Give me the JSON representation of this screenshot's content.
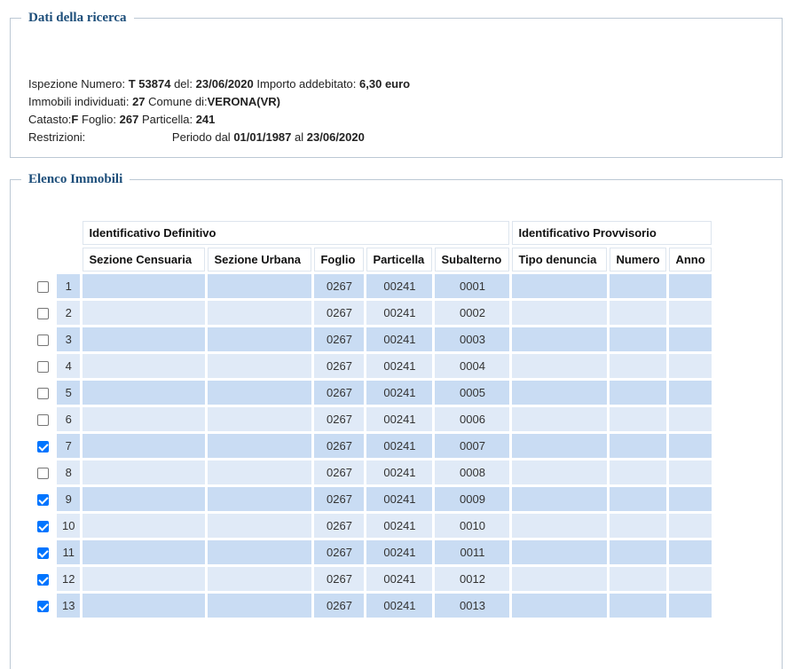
{
  "search": {
    "legend": "Dati della ricerca",
    "ispezione_label": "Ispezione Numero:",
    "ispezione_value": "T 53874",
    "del_label": "del:",
    "del_value": "23/06/2020",
    "importo_label": "Importo addebitato:",
    "importo_value": "6,30 euro",
    "immobili_label": "Immobili individuati:",
    "immobili_value": "27",
    "comune_label": "Comune di:",
    "comune_value": "VERONA(VR)",
    "catasto_label": "Catasto:",
    "catasto_value": "F",
    "foglio_label": "Foglio:",
    "foglio_value": "267",
    "particella_label": "Particella:",
    "particella_value": "241",
    "restrizioni_label": "Restrizioni:",
    "periodo_label": "Periodo dal",
    "periodo_from": "01/01/1987",
    "periodo_al": "al",
    "periodo_to": "23/06/2020"
  },
  "list": {
    "legend": "Elenco Immobili",
    "group_headers": {
      "definitivo": "Identificativo Definitivo",
      "provvisorio": "Identificativo Provvisorio"
    },
    "columns": {
      "sezione_censuaria": "Sezione Censuaria",
      "sezione_urbana": "Sezione Urbana",
      "foglio": "Foglio",
      "particella": "Particella",
      "subalterno": "Subalterno",
      "tipo_denuncia": "Tipo denuncia",
      "numero": "Numero",
      "anno": "Anno"
    },
    "rows": [
      {
        "n": "1",
        "checked": false,
        "foglio": "0267",
        "particella": "00241",
        "subalterno": "0001"
      },
      {
        "n": "2",
        "checked": false,
        "foglio": "0267",
        "particella": "00241",
        "subalterno": "0002"
      },
      {
        "n": "3",
        "checked": false,
        "foglio": "0267",
        "particella": "00241",
        "subalterno": "0003"
      },
      {
        "n": "4",
        "checked": false,
        "foglio": "0267",
        "particella": "00241",
        "subalterno": "0004"
      },
      {
        "n": "5",
        "checked": false,
        "foglio": "0267",
        "particella": "00241",
        "subalterno": "0005"
      },
      {
        "n": "6",
        "checked": false,
        "foglio": "0267",
        "particella": "00241",
        "subalterno": "0006"
      },
      {
        "n": "7",
        "checked": true,
        "foglio": "0267",
        "particella": "00241",
        "subalterno": "0007"
      },
      {
        "n": "8",
        "checked": false,
        "foglio": "0267",
        "particella": "00241",
        "subalterno": "0008"
      },
      {
        "n": "9",
        "checked": true,
        "foglio": "0267",
        "particella": "00241",
        "subalterno": "0009"
      },
      {
        "n": "10",
        "checked": true,
        "foglio": "0267",
        "particella": "00241",
        "subalterno": "0010"
      },
      {
        "n": "11",
        "checked": true,
        "foglio": "0267",
        "particella": "00241",
        "subalterno": "0011"
      },
      {
        "n": "12",
        "checked": true,
        "foglio": "0267",
        "particella": "00241",
        "subalterno": "0012"
      },
      {
        "n": "13",
        "checked": true,
        "foglio": "0267",
        "particella": "00241",
        "subalterno": "0013"
      }
    ]
  },
  "colors": {
    "legend": "#1d4e7a",
    "row_dark": "#c9dcf3",
    "row_light": "#e0eaf7",
    "checkbox_on": "#0075ff"
  }
}
